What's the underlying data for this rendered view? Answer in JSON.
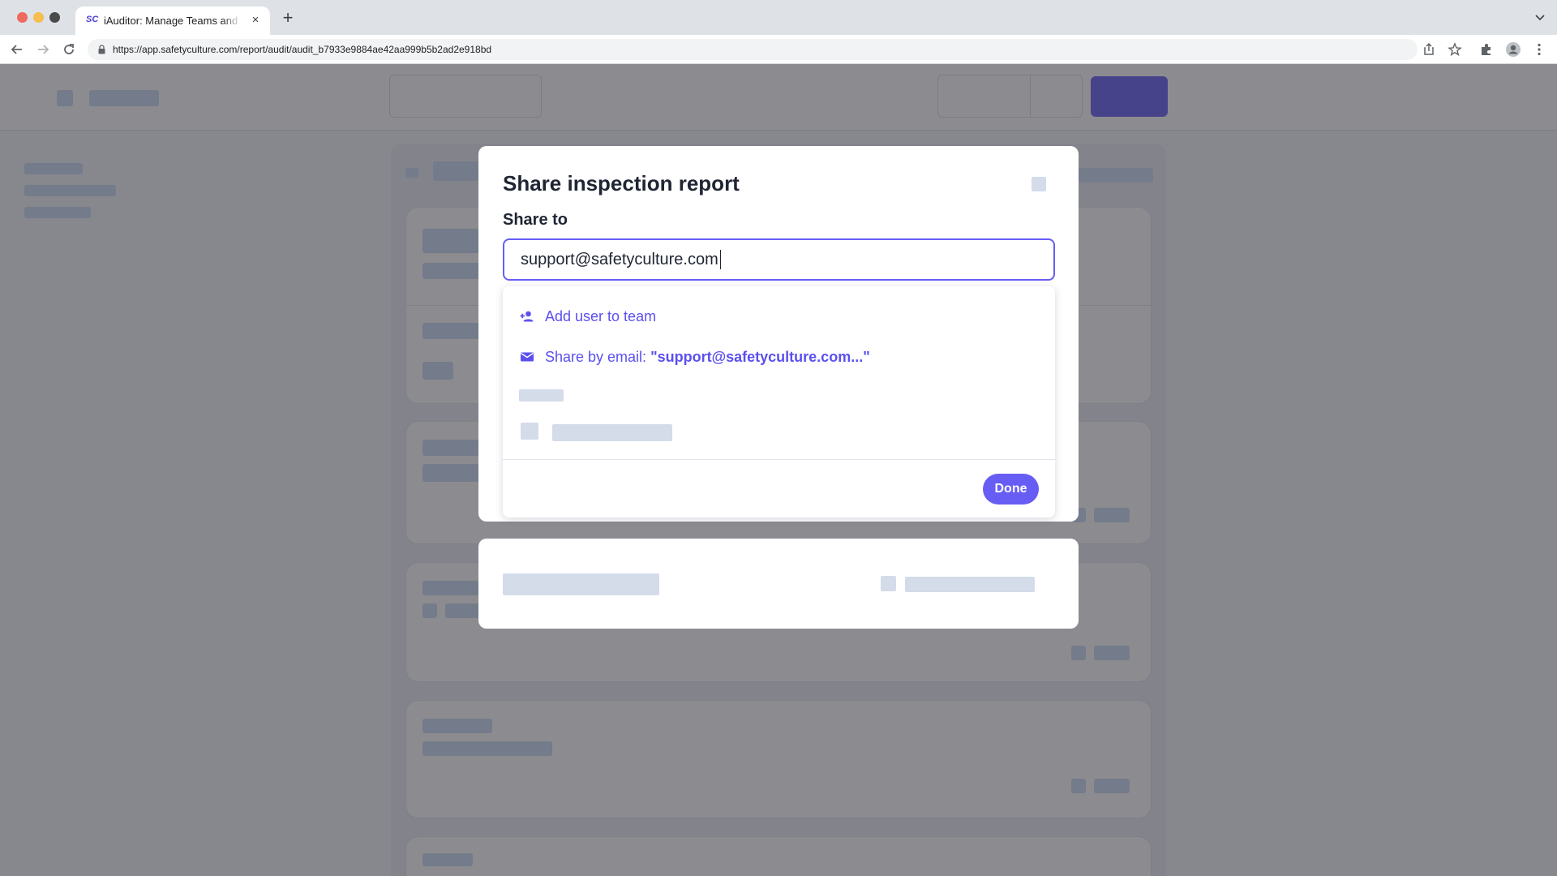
{
  "browser": {
    "tab_title": "iAuditor: Manage Teams and Inspections",
    "tab_favicon": "SC",
    "new_tab_symbol": "+",
    "close_tab_symbol": "×",
    "url": "https://app.safetyculture.com/report/audit/audit_b7933e9884ae42aa999b5b2ad2e918bd"
  },
  "modal": {
    "title": "Share inspection report",
    "share_to_label": "Share to",
    "input_value": "support@safetyculture.com",
    "suggestions": {
      "add_user_label": "Add user to team",
      "share_email_prefix": "Share by email: ",
      "share_email_value": "\"support@safetyculture.com...\""
    },
    "done_label": "Done"
  },
  "colors": {
    "accent": "#675df4",
    "overlay": "rgba(45,46,52,0.55)",
    "skeleton": "#d4dbe9"
  },
  "icons": {
    "add_user": "person-add-icon",
    "email": "envelope-icon",
    "close": "close-icon",
    "lock": "lock-icon"
  }
}
